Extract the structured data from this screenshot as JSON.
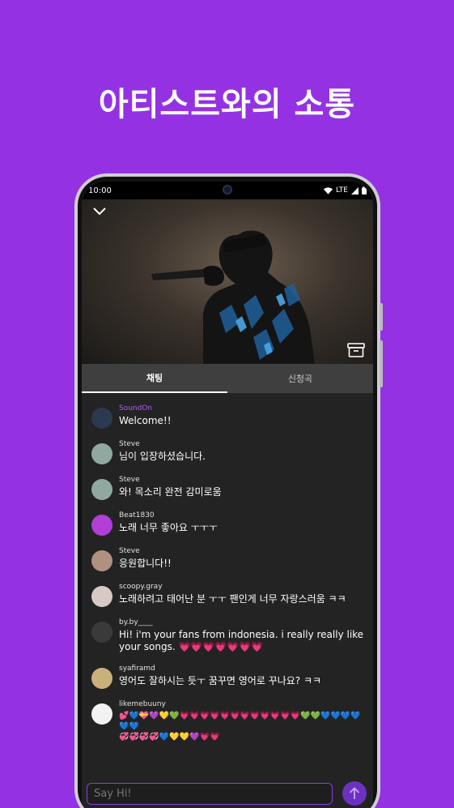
{
  "headline": "아티스트와의 소통",
  "status": {
    "time": "10:00",
    "network": "LTE"
  },
  "tabs": [
    {
      "label": "채팅",
      "active": true
    },
    {
      "label": "신청곡",
      "active": false
    }
  ],
  "messages": [
    {
      "user": "SoundOn",
      "text": "Welcome!!",
      "avatar_color": "#2b3a50",
      "highlight": true
    },
    {
      "user": "Steve",
      "text": "님이 입장하셨습니다.",
      "avatar_color": "#8fa9a0"
    },
    {
      "user": "Steve",
      "text": "와! 목소리 완전 감미로움",
      "avatar_color": "#8fa9a0"
    },
    {
      "user": "Beat1830",
      "text": "노래 너무 좋아요 ㅜㅜㅜ",
      "avatar_color": "#b13ed6"
    },
    {
      "user": "Steve",
      "text": "응원합니다!!",
      "avatar_color": "#b09080"
    },
    {
      "user": "scoopy.gray",
      "text": "노래하려고 태어난 분 ㅜㅜ 팬인게 너무 자랑스러움 ㅋㅋ",
      "avatar_color": "#d9c9c4"
    },
    {
      "user": "by.by____",
      "text": "Hi! i'm your fans from indonesia. i really really like your songs. 💗💗💗💗💗💗💗",
      "avatar_color": "#3a3a3a"
    },
    {
      "user": "syafiramd",
      "text": "영어도 잘하시는 듯ㅜ 꿈꾸면 영어로 꾸나요? ㅋㅋ",
      "avatar_color": "#c9b27a"
    },
    {
      "user": "likemebuuny",
      "text": "💕💙💝💜💛💚💗💗💗💗💗💗💗💗💗💗💗💗💚💚💙💙💙💙💙💙\n💞💞💞💞💙💛💛💜💗💗",
      "avatar_color": "#f2f2f2"
    }
  ],
  "input": {
    "placeholder": "Say Hi!"
  },
  "colors": {
    "background": "#9432e3",
    "accent": "#a663f0",
    "chat_bg": "#232323"
  },
  "icons": [
    "chevron-down-icon",
    "archive-box-icon",
    "send-arrow-icon",
    "wifi-icon",
    "signal-icon",
    "battery-icon"
  ]
}
